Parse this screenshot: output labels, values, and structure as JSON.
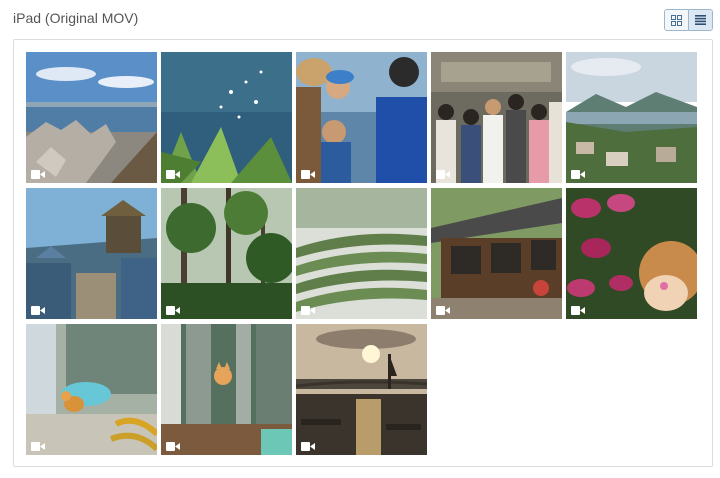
{
  "header": {
    "title": "iPad (Original MOV)"
  },
  "view_toggle": {
    "grid_icon": "grid-icon",
    "list_icon": "list-icon",
    "active": "list"
  },
  "thumbnails": [
    {
      "subject": "breakwater-tetrapods-sea",
      "type": "video"
    },
    {
      "subject": "sparkling-sea-ferns",
      "type": "video"
    },
    {
      "subject": "people-boy-blue-cap",
      "type": "video"
    },
    {
      "subject": "crowd-street",
      "type": "video"
    },
    {
      "subject": "coastal-town-hills",
      "type": "video"
    },
    {
      "subject": "temple-rooftops",
      "type": "video"
    },
    {
      "subject": "forest-trees",
      "type": "video"
    },
    {
      "subject": "tea-terraces",
      "type": "video"
    },
    {
      "subject": "wooden-house",
      "type": "video"
    },
    {
      "subject": "pink-leaves-doll",
      "type": "video"
    },
    {
      "subject": "cat-blue-basin",
      "type": "video"
    },
    {
      "subject": "cat-behind-door",
      "type": "video"
    },
    {
      "subject": "sunset-harbor",
      "type": "video"
    }
  ],
  "icons": {
    "video": "video-camera-icon"
  }
}
